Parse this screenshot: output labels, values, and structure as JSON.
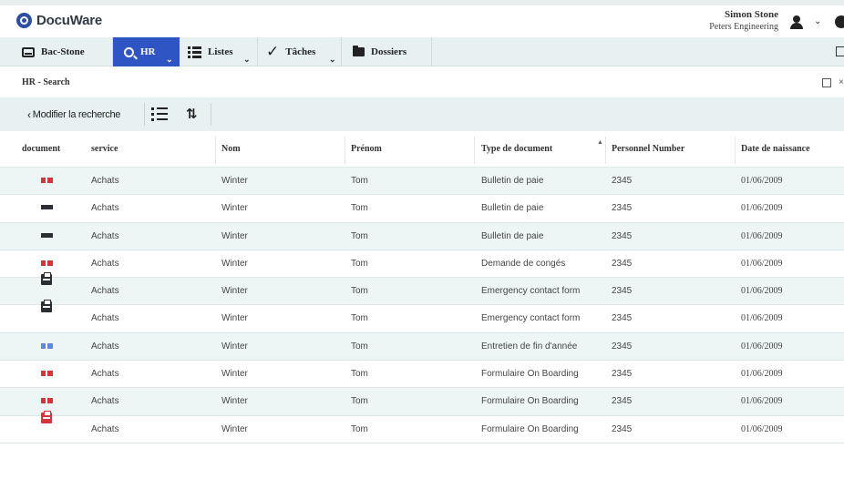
{
  "app": {
    "logo_text": "DocuWare",
    "user_name": "Simon Stone",
    "user_company": "Peters Engineering"
  },
  "nav": {
    "items": [
      {
        "label": "Bac-Stone",
        "icon": "basket-icon"
      },
      {
        "label": "HR",
        "icon": "search-icon",
        "active": true
      },
      {
        "label": "Listes",
        "icon": "list-icon"
      },
      {
        "label": "Tâches",
        "icon": "checkmark-icon"
      },
      {
        "label": "Dossiers",
        "icon": "folder-icon"
      }
    ]
  },
  "breadcrumb": "HR - Search",
  "toolbar": {
    "back_label": "Modifier la recherche"
  },
  "table": {
    "columns": [
      "document",
      "service",
      "Nom",
      "Prénom",
      "Type de document",
      "Personnel Number",
      "Date de naissance"
    ],
    "rows": [
      {
        "icon": "pdf",
        "service": "Achats",
        "nom": "Winter",
        "prenom": "Tom",
        "type": "Bulletin de paie",
        "number": "2345",
        "date": "01/06/2009"
      },
      {
        "icon": "dark",
        "service": "Achats",
        "nom": "Winter",
        "prenom": "Tom",
        "type": "Bulletin de paie",
        "number": "2345",
        "date": "01/06/2009"
      },
      {
        "icon": "dark",
        "service": "Achats",
        "nom": "Winter",
        "prenom": "Tom",
        "type": "Bulletin de paie",
        "number": "2345",
        "date": "01/06/2009"
      },
      {
        "icon": "pdf",
        "service": "Achats",
        "nom": "Winter",
        "prenom": "Tom",
        "type": "Demande de congés",
        "number": "2345",
        "date": "01/06/2009"
      },
      {
        "icon": "clip",
        "service": "Achats",
        "nom": "Winter",
        "prenom": "Tom",
        "type": "Emergency contact form",
        "number": "2345",
        "date": "01/06/2009"
      },
      {
        "icon": "clip",
        "service": "Achats",
        "nom": "Winter",
        "prenom": "Tom",
        "type": "Emergency contact form",
        "number": "2345",
        "date": "01/06/2009"
      },
      {
        "icon": "word",
        "service": "Achats",
        "nom": "Winter",
        "prenom": "Tom",
        "type": "Entretien de fin d'année",
        "number": "2345",
        "date": "01/06/2009"
      },
      {
        "icon": "pdf",
        "service": "Achats",
        "nom": "Winter",
        "prenom": "Tom",
        "type": "Formulaire On Boarding",
        "number": "2345",
        "date": "01/06/2009"
      },
      {
        "icon": "pdf",
        "service": "Achats",
        "nom": "Winter",
        "prenom": "Tom",
        "type": "Formulaire On Boarding",
        "number": "2345",
        "date": "01/06/2009"
      },
      {
        "icon": "clip-red",
        "service": "Achats",
        "nom": "Winter",
        "prenom": "Tom",
        "type": "Formulaire On Boarding",
        "number": "2345",
        "date": "01/06/2009"
      }
    ]
  },
  "colors": {
    "brand": "#2d4fa1",
    "active_tab": "#2f55c5",
    "bar_background": "#e7f1f1",
    "row_alt": "#eef5f5",
    "pdf_red": "#d5343a",
    "word_blue": "#5b8ad6"
  }
}
